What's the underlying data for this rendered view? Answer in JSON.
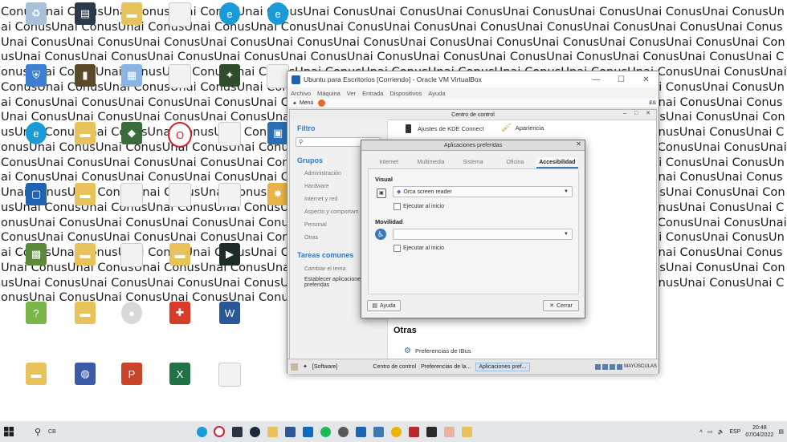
{
  "wallpaper": {
    "text": "ConusUnai ConusUnai ConusUnai ConusUnai ConusUnai ConusUnai ConusUnai ConusUnai ConusUnai ConusUnai ConusUnai ConusUnai ConusUnai ConusUnai ConusUnai ConusUnai ConusUnai ConusUnai ConusUnai ConusUnai ConusUnai ConusUnai ConusUnai ConusUnai ConusUnai ConusUnai ConusUnai ConusUnai ConusUnai ConusUnai ConusUnai ConusUnai ConusUnai ConusUnai ConusUnai ConusUnai ConusUnai ConusUnai ConusUnai ConusUnai ConusUnai ConusUnai ConusUnai ConusUnai ConusUnai ConusUnai ConusUnai ConusUnai ConusUnai ConusUnai ConusUnai ConusUnai ConusUnai ConusUnai ConusUnai ConusUnai ConusUnai ConusUnai ConusUnai ConusUnai ConusUnai ConusUnai ConusUnai ConusUnai ConusUnai ConusUnai ConusUnai ConusUnai ConusUnai ConusUnai ConusUnai ConusUnai ConusUnai ConusUnai ConusUnai ConusUnai ConusUnai ConusUnai ConusUnai ConusUnai ConusUnai ConusUnai ConusUnai ConusUnai ConusUnai ConusUnai ConusUnai ConusUnai ConusUnai ConusUnai ConusUnai ConusUnai ConusUnai ConusUnai ConusUnai ConusUnai ConusUnai ConusUnai ConusUnai ConusUnai ConusUnai ConusUnai ConusUnai ConusUnai ConusUnai ConusUnai ConusUnai ConusUnai ConusUnai ConusUnai ConusUnai ConusUnai ConusUnai ConusUnai ConusUnai ConusUnai ConusUnai ConusUnai ConusUnai ConusUnai ConusUnai ConusUnai ConusUnai ConusUnai ConusUnai ConusUnai ConusUnai ConusUnai ConusUnai ConusUnai ConusUnai ConusUnai ConusUnai ConusUnai ConusUnai ConusUnai ConusUnai ConusUnai ConusUnai ConusUnai ConusUnai ConusUnai ConusUnai ConusUnai ConusUnai ConusUnai ConusUnai ConusUnai ConusUnai ConusUnai ConusUnai ConusUnai ConusUnai ConusUnai ConusUnai ConusUnai ConusUnai ConusUnai ConusUnai ConusUnai ConusUnai ConusUnai ConusUnai ConusUnai ConusUnai ConusUnai ConusUnai ConusUnai ConusUnai ConusUnai ConusUnai ConusUnai ConusUnai ConusUnai ConusUnai ConusUnai ConusUnai ConusUnai ConusUnai ConusUnai ConusUnai ConusUnai ConusUnai ConusUnai ConusUnai ConusUnai ConusUnai ConusUnai ConusUnai ConusUnai ConusUnai ConusUnai ConusUnai ConusUnai ConusUnai ConusUnai ConusUnai ConusUnai ConusUnai ConusUnai ConusUnai ConusUnai ConusUnai ConusUnai ConusUnai ConusUnai ConusUnai ConusUnai ConusUnai ConusUnai ConusUnai ConusUnai ConusUnai ConusUnai ConusUnai ConusUnai ConusUnai ConusUnai ConusUnai ConusUnai ConusUnai ConusUnai ConusUnai ConusUnai ConusUnai ConusUnai ConusUnai ConusUnai ConusUnai ConusUnai ConusUnai ConusUnai ConusUnai Conus"
  },
  "vbox": {
    "title": "Ubuntu para Escritorios [Corriendo] - Oracle VM VirtualBox",
    "menu": [
      "Archivo",
      "Máquina",
      "Ver",
      "Entrada",
      "Dispositivos",
      "Ayuda"
    ]
  },
  "guest": {
    "menu_label": "Menú",
    "lang": "ES",
    "taskbar": {
      "items": [
        "[Software]",
        "Centro de control",
        "Preferencias de la...",
        "Aplicaciones pref..."
      ],
      "caps": "MAYÚSCULAS"
    }
  },
  "control_center": {
    "title": "Centro de control",
    "filter_heading": "Filtro",
    "groups_heading": "Grupos",
    "groups": [
      "Administración",
      "Hardware",
      "Internet y red",
      "Aspecto y comportam",
      "Personal",
      "Otras"
    ],
    "tasks_heading": "Tareas comunes",
    "tasks": [
      "Cambiar el tema",
      "Establecer aplicaciones preferidas"
    ],
    "items": {
      "kde_connect": "Ajustes de KDE Connect",
      "appearance": "Apariencia",
      "other_heading": "Otras",
      "ibus": "Preferencias de IBus"
    }
  },
  "dialog": {
    "title": "Aplicaciones preferidas",
    "tabs": [
      "Internet",
      "Multimedia",
      "Sistema",
      "Oficina",
      "Accesibilidad"
    ],
    "active_tab": "Accesibilidad",
    "visual_label": "Visual",
    "visual_value": "Orca screen reader",
    "start_label": "Ejecutar al inicio",
    "mobility_label": "Movilidad",
    "mobility_value": "",
    "help_label": "Ayuda",
    "close_label": "Cerrar"
  },
  "taskbar": {
    "search_text": "CB",
    "lang": "ESP",
    "time": "20:48",
    "date": "07/04/2022"
  },
  "colors": {
    "accent": "#3a78b8",
    "taskbar": "#e3e7ea"
  }
}
